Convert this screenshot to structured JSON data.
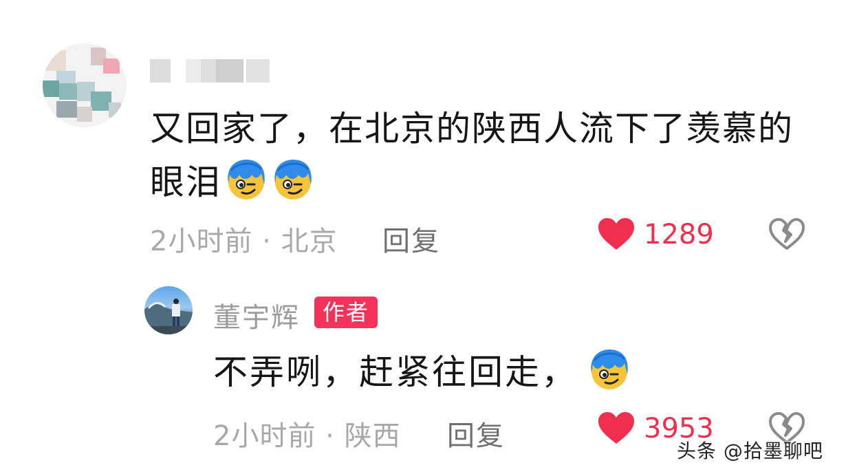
{
  "comment": {
    "text_line1": "又回家了，在北京的陕西人流下了羡慕的",
    "text_line2": "眼泪",
    "time_location": "2小时前 · 北京",
    "reply_label": "回复",
    "likes": "1289",
    "emoji": [
      "smirk-face-blue-hair-emoji",
      "smirk-face-blue-hair-emoji"
    ]
  },
  "reply": {
    "author_name": "董宇辉",
    "author_badge": "作者",
    "text": "不弄咧，赶紧往回走，",
    "time_location": "2小时前 · 陕西",
    "reply_label": "回复",
    "likes": "3953",
    "emoji": [
      "smirk-face-blue-hair-emoji"
    ]
  },
  "watermark": "头条 @拾墨聊吧",
  "colors": {
    "like_red": "#f02e4e",
    "badge_red": "#f5335a",
    "meta_gray": "#a8a8a8",
    "text_dark": "#161616"
  }
}
